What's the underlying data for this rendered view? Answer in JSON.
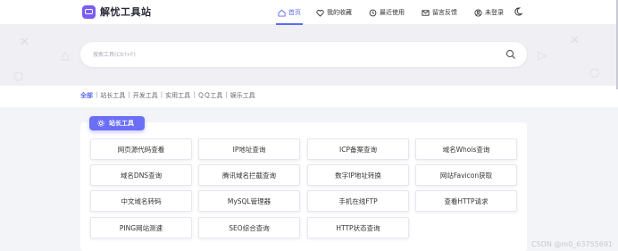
{
  "header": {
    "brand": "解忧工具站",
    "nav": [
      {
        "label": "首页",
        "icon": "home-icon",
        "active": true
      },
      {
        "label": "我的收藏",
        "icon": "heart-icon",
        "active": false
      },
      {
        "label": "最近使用",
        "icon": "history-icon",
        "active": false
      },
      {
        "label": "留言反馈",
        "icon": "message-icon",
        "active": false
      },
      {
        "label": "未登录",
        "icon": "user-icon",
        "active": false
      }
    ],
    "theme_icon": "moon-icon"
  },
  "search": {
    "placeholder": "搜索工具(Ctrl+F)",
    "value": ""
  },
  "categories": [
    {
      "label": "全部",
      "active": true
    },
    {
      "label": "站长工具",
      "active": false
    },
    {
      "label": "开发工具",
      "active": false
    },
    {
      "label": "实用工具",
      "active": false
    },
    {
      "label": "ＱＱ工具",
      "active": false
    },
    {
      "label": "娱乐工具",
      "active": false
    }
  ],
  "section": {
    "title": "站长工具",
    "icon": "gear-icon",
    "tools": [
      "网页源代码查看",
      "IP地址查询",
      "ICP备案查询",
      "域名Whois查询",
      "域名DNS查询",
      "腾讯域名拦截查询",
      "数字IP地址转换",
      "网站Favicon获取",
      "中文域名转码",
      "MySQL管理器",
      "手机在线FTP",
      "查看HTTP请求",
      "PING网站测速",
      "SEO综合查询",
      "HTTP状态查询"
    ]
  },
  "watermark": "CSDN @m0_63755691",
  "colors": {
    "accent": "#5b6cf0",
    "brand_logo": "#7a5cf2",
    "tag_bg": "#6a6ff5"
  }
}
